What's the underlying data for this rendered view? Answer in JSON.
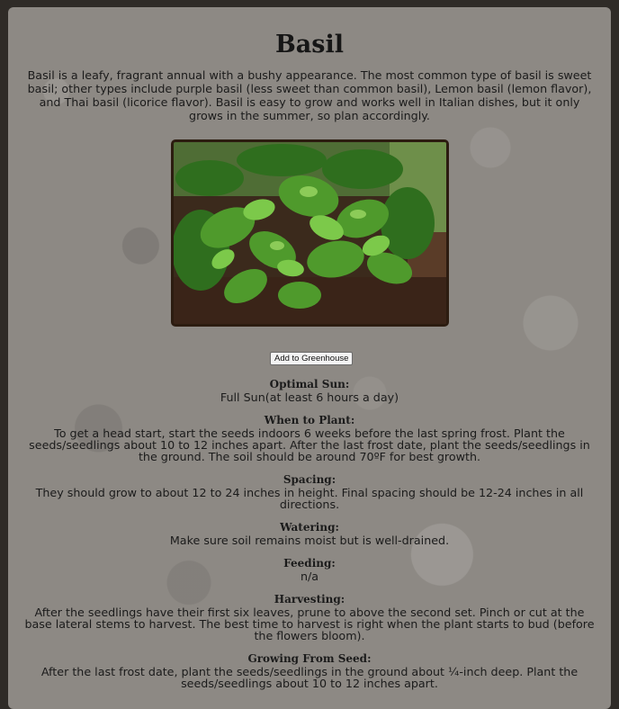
{
  "plant": {
    "title": "Basil",
    "description": "Basil is a leafy, fragrant annual with a bushy appearance. The most common type of basil is sweet basil; other types include purple basil (less sweet than common basil), Lemon basil (lemon flavor), and Thai basil (licorice flavor). Basil is easy to grow and works well in Italian dishes, but it only grows in the summer, so plan accordingly.",
    "add_button_label": "Add to Greenhouse"
  },
  "sections": {
    "sun": {
      "label": "Optimal Sun:",
      "text": "Full Sun(at least 6 hours a day)"
    },
    "when": {
      "label": "When to Plant:",
      "text": "To get a head start, start the seeds indoors 6 weeks before the last spring frost. Plant the seeds/seedlings about 10 to 12 inches apart. After the last frost date, plant the seeds/seedlings in the ground. The soil should be around 70ºF for best growth."
    },
    "spacing": {
      "label": "Spacing:",
      "text": "They should grow to about 12 to 24 inches in height. Final spacing should be 12-24 inches in all directions."
    },
    "watering": {
      "label": "Watering:",
      "text": "Make sure soil remains moist but is well-drained."
    },
    "feeding": {
      "label": "Feeding:",
      "text": "n/a"
    },
    "harvesting": {
      "label": "Harvesting:",
      "text": "After the seedlings have their first six leaves, prune to above the second set. Pinch or cut at the base lateral stems to harvest. The best time to harvest is right when the plant starts to bud (before the flowers bloom)."
    },
    "seed": {
      "label": "Growing From Seed:",
      "text": "After the last frost date, plant the seeds/seedlings in the ground about ¼-inch deep. Plant the seeds/seedlings about 10 to 12 inches apart."
    }
  }
}
